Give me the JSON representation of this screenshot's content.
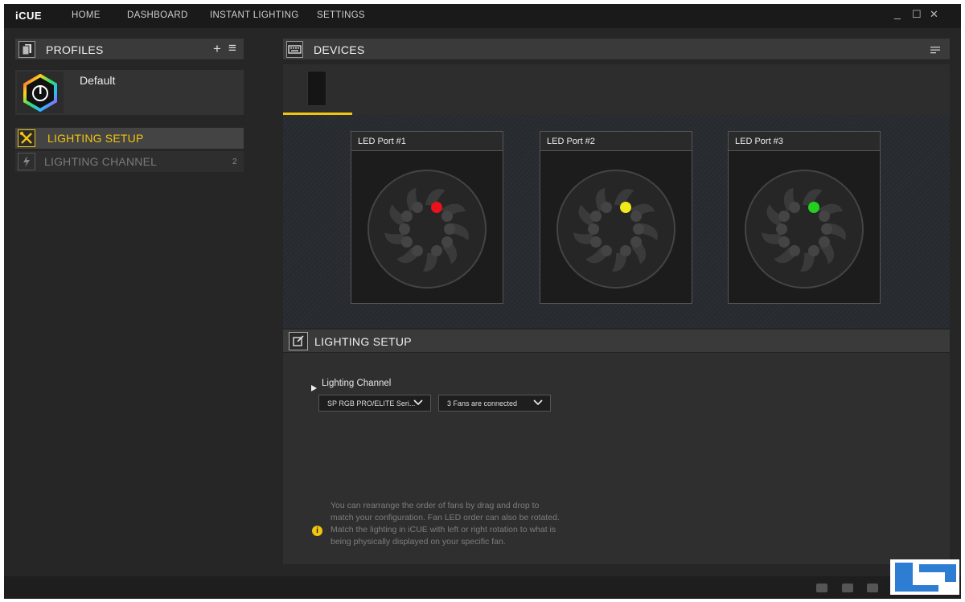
{
  "app": {
    "brand": "iCUE"
  },
  "nav": {
    "items": [
      {
        "label": "HOME"
      },
      {
        "label": "DASHBOARD"
      },
      {
        "label": "INSTANT LIGHTING"
      },
      {
        "label": "SETTINGS"
      }
    ],
    "window_controls": {
      "minimize": "_",
      "maximize": "☐",
      "close": "✕"
    }
  },
  "profiles": {
    "title": "PROFILES",
    "add_icon": "+",
    "menu_icon": "≡",
    "items": [
      {
        "name": "Default"
      }
    ]
  },
  "left_menu": {
    "items": [
      {
        "label": "LIGHTING SETUP",
        "active": true,
        "color": "#f1c40f"
      },
      {
        "label": "LIGHTING CHANNEL",
        "badge": "2",
        "active": false
      }
    ]
  },
  "devices": {
    "title": "DEVICES",
    "ports": [
      {
        "label": "LED Port #1",
        "led_color": "#e8121a"
      },
      {
        "label": "LED Port #2",
        "led_color": "#f0ea1a"
      },
      {
        "label": "LED Port #3",
        "led_color": "#22d11e"
      }
    ]
  },
  "lighting_setup": {
    "title": "LIGHTING SETUP",
    "channel_label": "Lighting Channel",
    "dropdown_fan_type": "SP RGB PRO/ELITE Seri...",
    "dropdown_fan_count": "3 Fans are connected",
    "info_text": "You can rearrange the order of fans by drag and drop to match your configuration. Fan LED order can also be rotated. Match the lighting in iCUE with left or right rotation to what is being physically displayed on your specific fan.",
    "info_icon": "i"
  },
  "colors": {
    "accent": "#f1c40f",
    "background": "#262626"
  }
}
